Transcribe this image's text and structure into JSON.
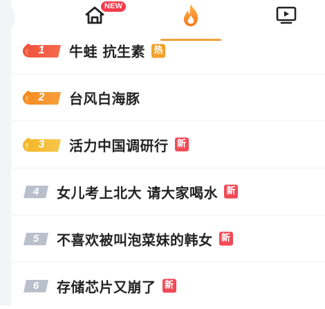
{
  "nav": {
    "tabs": [
      {
        "id": "home",
        "icon": "home-icon",
        "badge": "NEW"
      },
      {
        "id": "hot",
        "icon": "flame-icon",
        "active": true
      },
      {
        "id": "video",
        "icon": "video-icon"
      }
    ],
    "colors": {
      "accent": "#f3a13a",
      "badge": "#f43a4a"
    }
  },
  "hot_list": {
    "items": [
      {
        "rank": "1",
        "title": "牛蛙 抗生素",
        "badge": "热",
        "badge_color": "#f3a12a"
      },
      {
        "rank": "2",
        "title": "台风白海豚",
        "badge": "",
        "badge_color": ""
      },
      {
        "rank": "3",
        "title": "活力中国调研行",
        "badge": "新",
        "badge_color": "#f04a56"
      },
      {
        "rank": "4",
        "title": "女儿考上北大 请大家喝水",
        "badge": "新",
        "badge_color": "#f04a56"
      },
      {
        "rank": "5",
        "title": "不喜欢被叫泡菜妹的韩女",
        "badge": "新",
        "badge_color": "#f04a56"
      },
      {
        "rank": "6",
        "title": "存储芯片又崩了",
        "badge": "新",
        "badge_color": "#f04a56"
      }
    ]
  }
}
